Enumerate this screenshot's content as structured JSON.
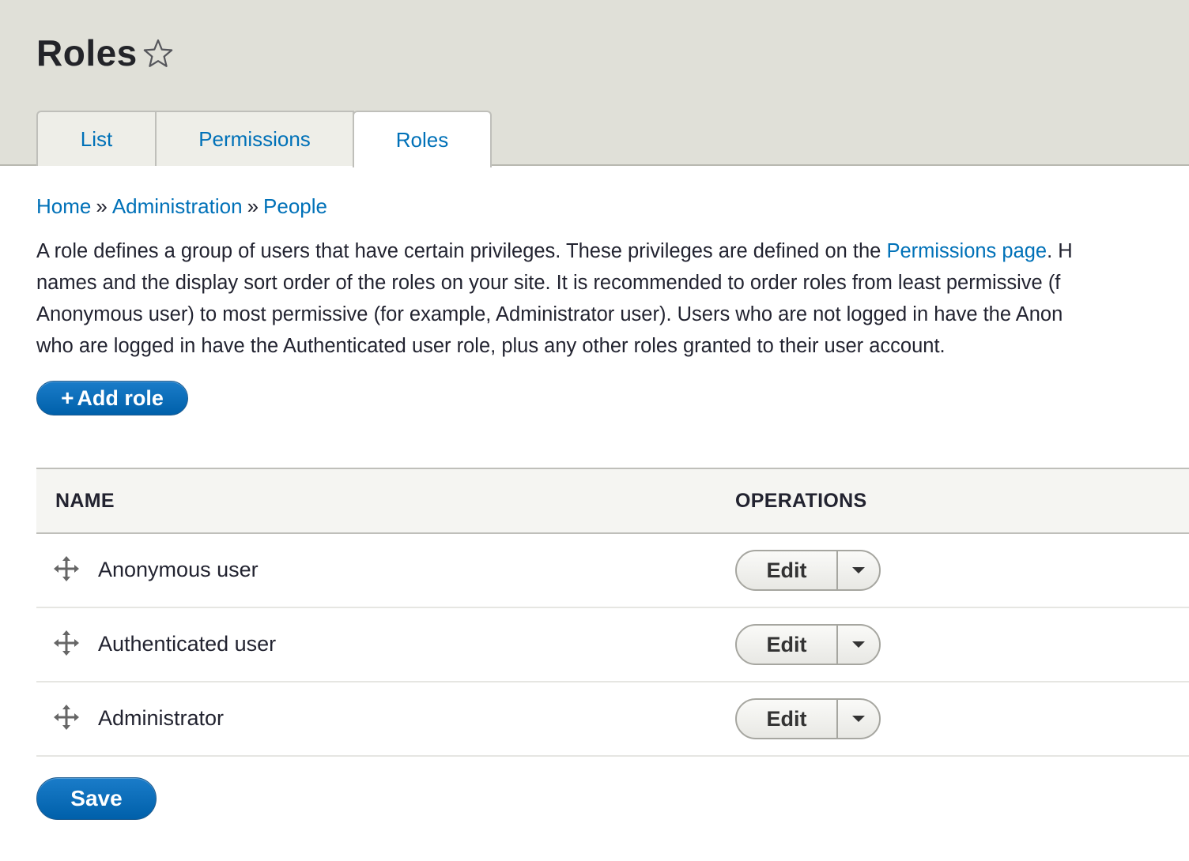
{
  "page": {
    "title": "Roles"
  },
  "tabs": [
    {
      "label": "List"
    },
    {
      "label": "Permissions"
    },
    {
      "label": "Roles",
      "active": true
    }
  ],
  "breadcrumb": {
    "items": [
      "Home",
      "Administration",
      "People"
    ],
    "separator": "»"
  },
  "description": {
    "line1_before": "A role defines a group of users that have certain privileges. These privileges are defined on the ",
    "link": "Permissions page",
    "line1_after": ". H",
    "line2": "names and the display sort order of the roles on your site. It is recommended to order roles from least permissive (f",
    "line3": "Anonymous user) to most permissive (for example, Administrator user). Users who are not logged in have the Anon",
    "line4": "who are logged in have the Authenticated user role, plus any other roles granted to their user account."
  },
  "actions": {
    "add_role_label": "Add role",
    "add_role_icon": "+",
    "save_label": "Save"
  },
  "table": {
    "headers": {
      "name": "NAME",
      "operations": "OPERATIONS"
    },
    "rows": [
      {
        "name": "Anonymous user",
        "operation": "Edit"
      },
      {
        "name": "Authenticated user",
        "operation": "Edit"
      },
      {
        "name": "Administrator",
        "operation": "Edit"
      }
    ]
  },
  "colors": {
    "link": "#0071b8",
    "primary_button": "#0071b8",
    "header_bg": "#e0e0d8"
  },
  "icons": {
    "favorite": "star-icon",
    "drag": "move-handle-icon",
    "dropdown": "caret-down-icon"
  }
}
